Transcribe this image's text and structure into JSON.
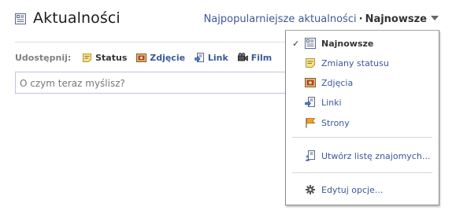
{
  "header": {
    "title": "Aktualności",
    "title_icon": "news-feed-icon",
    "sort_top_label": "Najpopularniejsze aktualności",
    "sort_separator": "·",
    "sort_current_label": "Najnowsze"
  },
  "share": {
    "label": "Udostępnij:",
    "items": [
      {
        "label": "Status",
        "icon": "status-icon"
      },
      {
        "label": "Zdjęcie",
        "icon": "photo-icon"
      },
      {
        "label": "Link",
        "icon": "link-icon"
      },
      {
        "label": "Film",
        "icon": "video-icon"
      }
    ],
    "input_placeholder": "O czym teraz myślisz?"
  },
  "dropdown": {
    "items": [
      {
        "label": "Najnowsze",
        "icon": "news-feed-icon",
        "selected": true
      },
      {
        "label": "Zmiany statusu",
        "icon": "status-icon",
        "selected": false
      },
      {
        "label": "Zdjęcia",
        "icon": "photo-icon",
        "selected": false
      },
      {
        "label": "Linki",
        "icon": "link-icon",
        "selected": false
      },
      {
        "label": "Strony",
        "icon": "pages-flag-icon",
        "selected": false
      },
      {
        "label": "Utwórz listę znajomych...",
        "icon": "friend-list-icon",
        "selected": false
      },
      {
        "label": "Edytuj opcje...",
        "icon": "gear-icon",
        "selected": false
      }
    ],
    "check_mark": "✓"
  },
  "colors": {
    "link": "#3b5998",
    "border": "#bdc7d8",
    "text": "#333333"
  }
}
